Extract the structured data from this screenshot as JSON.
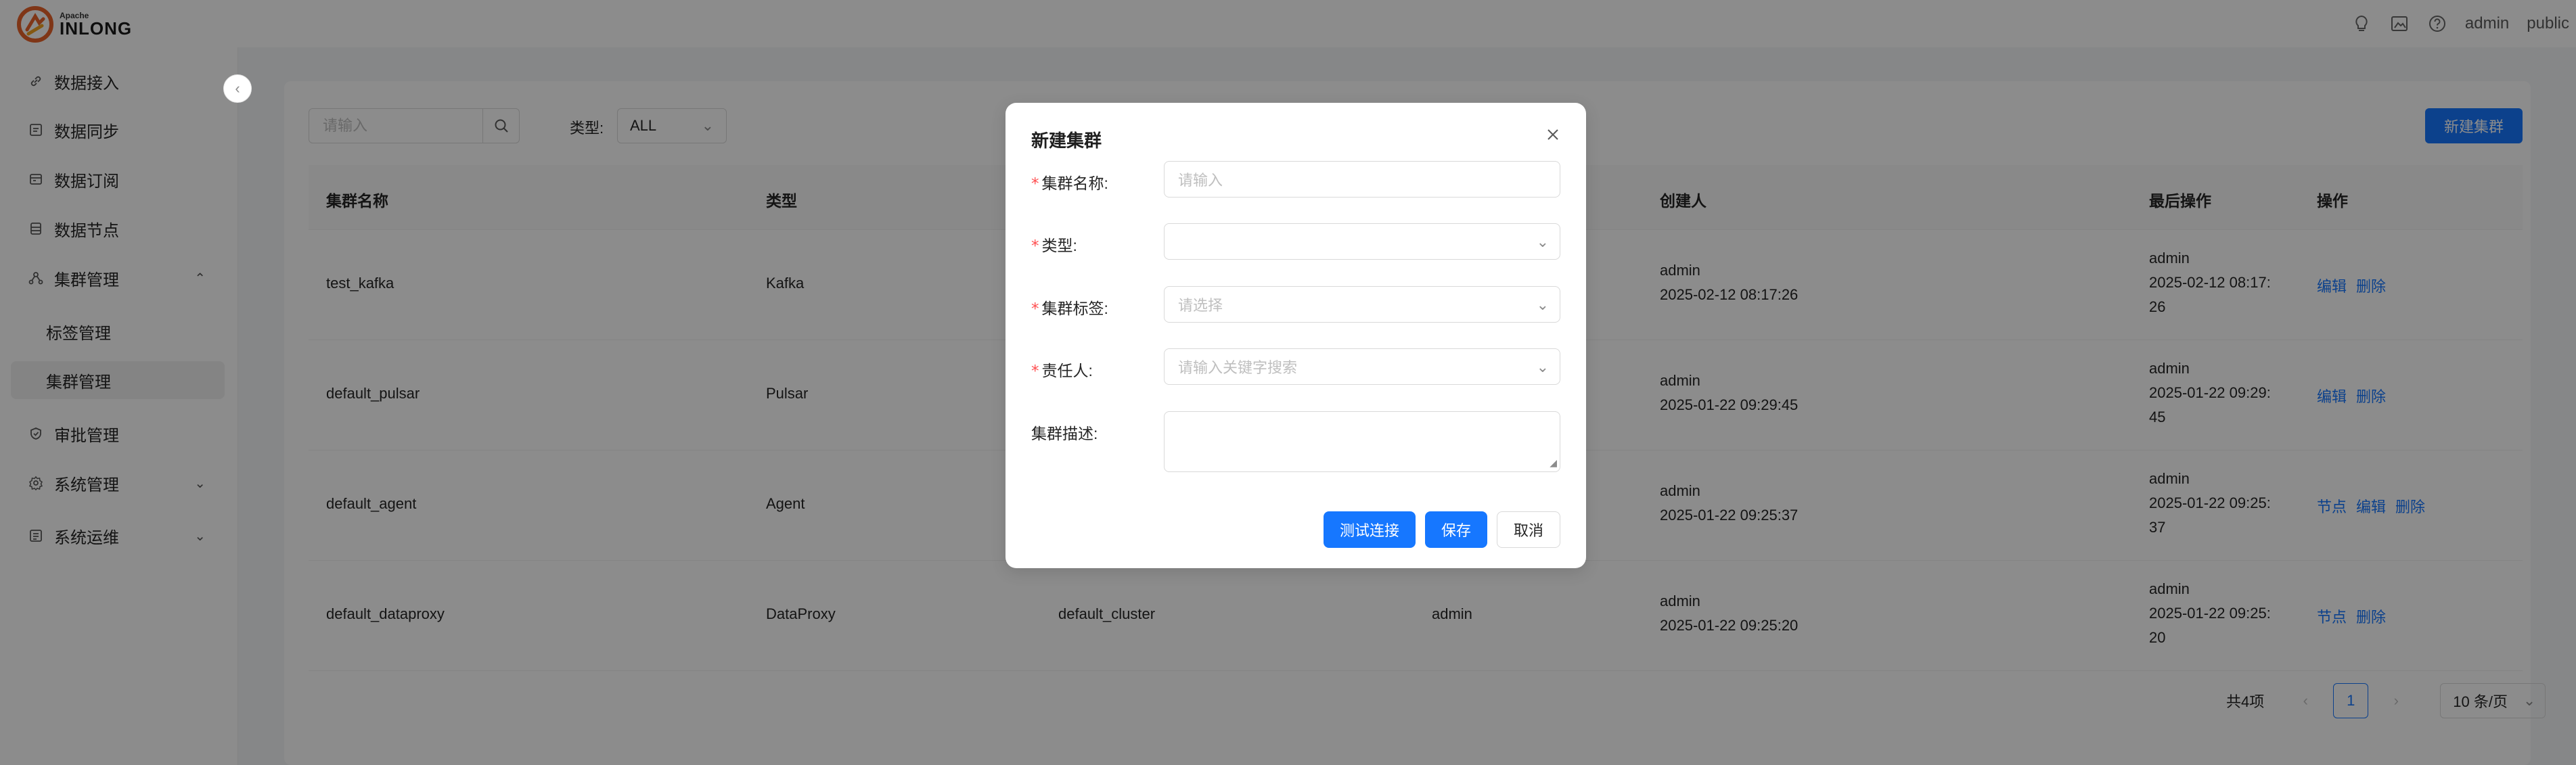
{
  "header": {
    "logo_top": "Apache",
    "logo_main": "INLONG",
    "user": "admin",
    "tenant": "public"
  },
  "sidebar": {
    "items": [
      {
        "label": "数据接入",
        "icon": "link-icon"
      },
      {
        "label": "数据同步",
        "icon": "sync-icon"
      },
      {
        "label": "数据订阅",
        "icon": "subscribe-icon"
      },
      {
        "label": "数据节点",
        "icon": "node-icon"
      },
      {
        "label": "集群管理",
        "icon": "cluster-icon",
        "expanded": true
      },
      {
        "label": "标签管理",
        "sub": true
      },
      {
        "label": "集群管理",
        "sub": true,
        "active": true
      },
      {
        "label": "审批管理",
        "icon": "approval-icon"
      },
      {
        "label": "系统管理",
        "icon": "settings-icon"
      },
      {
        "label": "系统运维",
        "icon": "ops-icon"
      }
    ]
  },
  "filter": {
    "search_placeholder": "请输入",
    "type_label": "类型:",
    "type_value": "ALL",
    "new_button": "新建集群"
  },
  "table": {
    "headers": [
      "集群名称",
      "类型",
      "",
      "",
      "创建人",
      "最后操作",
      "操作"
    ],
    "rows": [
      {
        "name": "test_kafka",
        "type": "Kafka",
        "tags": "",
        "owner": "",
        "creator": "admin",
        "created": "2025-02-12 08:17:26",
        "modifier": "admin",
        "modified_1": "2025-02-12 08:17:",
        "modified_2": "26",
        "actions": [
          "编辑",
          "删除"
        ]
      },
      {
        "name": "default_pulsar",
        "type": "Pulsar",
        "tags": "",
        "owner": "",
        "creator": "admin",
        "created": "2025-01-22 09:29:45",
        "modifier": "admin",
        "modified_1": "2025-01-22 09:29:",
        "modified_2": "45",
        "actions": [
          "编辑",
          "删除"
        ]
      },
      {
        "name": "default_agent",
        "type": "Agent",
        "tags": "",
        "owner": "",
        "creator": "admin",
        "created": "2025-01-22 09:25:37",
        "modifier": "admin",
        "modified_1": "2025-01-22 09:25:",
        "modified_2": "37",
        "actions": [
          "节点",
          "编辑",
          "删除"
        ]
      },
      {
        "name": "default_dataproxy",
        "type": "DataProxy",
        "tags": "default_cluster",
        "owner": "admin",
        "creator": "admin",
        "created": "2025-01-22 09:25:20",
        "modifier": "admin",
        "modified_1": "2025-01-22 09:25:",
        "modified_2": "20",
        "actions": [
          "节点",
          "删除"
        ]
      }
    ]
  },
  "pagination": {
    "total": "共4项",
    "page": "1",
    "page_size": "10 条/页"
  },
  "modal": {
    "title": "新建集群",
    "fields": {
      "name_label": "集群名称:",
      "name_placeholder": "请输入",
      "type_label": "类型:",
      "tags_label": "集群标签:",
      "tags_placeholder": "请选择",
      "owner_label": "责任人:",
      "owner_placeholder": "请输入关键字搜索",
      "desc_label": "集群描述:"
    },
    "required_mark": "*",
    "buttons": {
      "test": "测试连接",
      "save": "保存",
      "cancel": "取消"
    }
  }
}
